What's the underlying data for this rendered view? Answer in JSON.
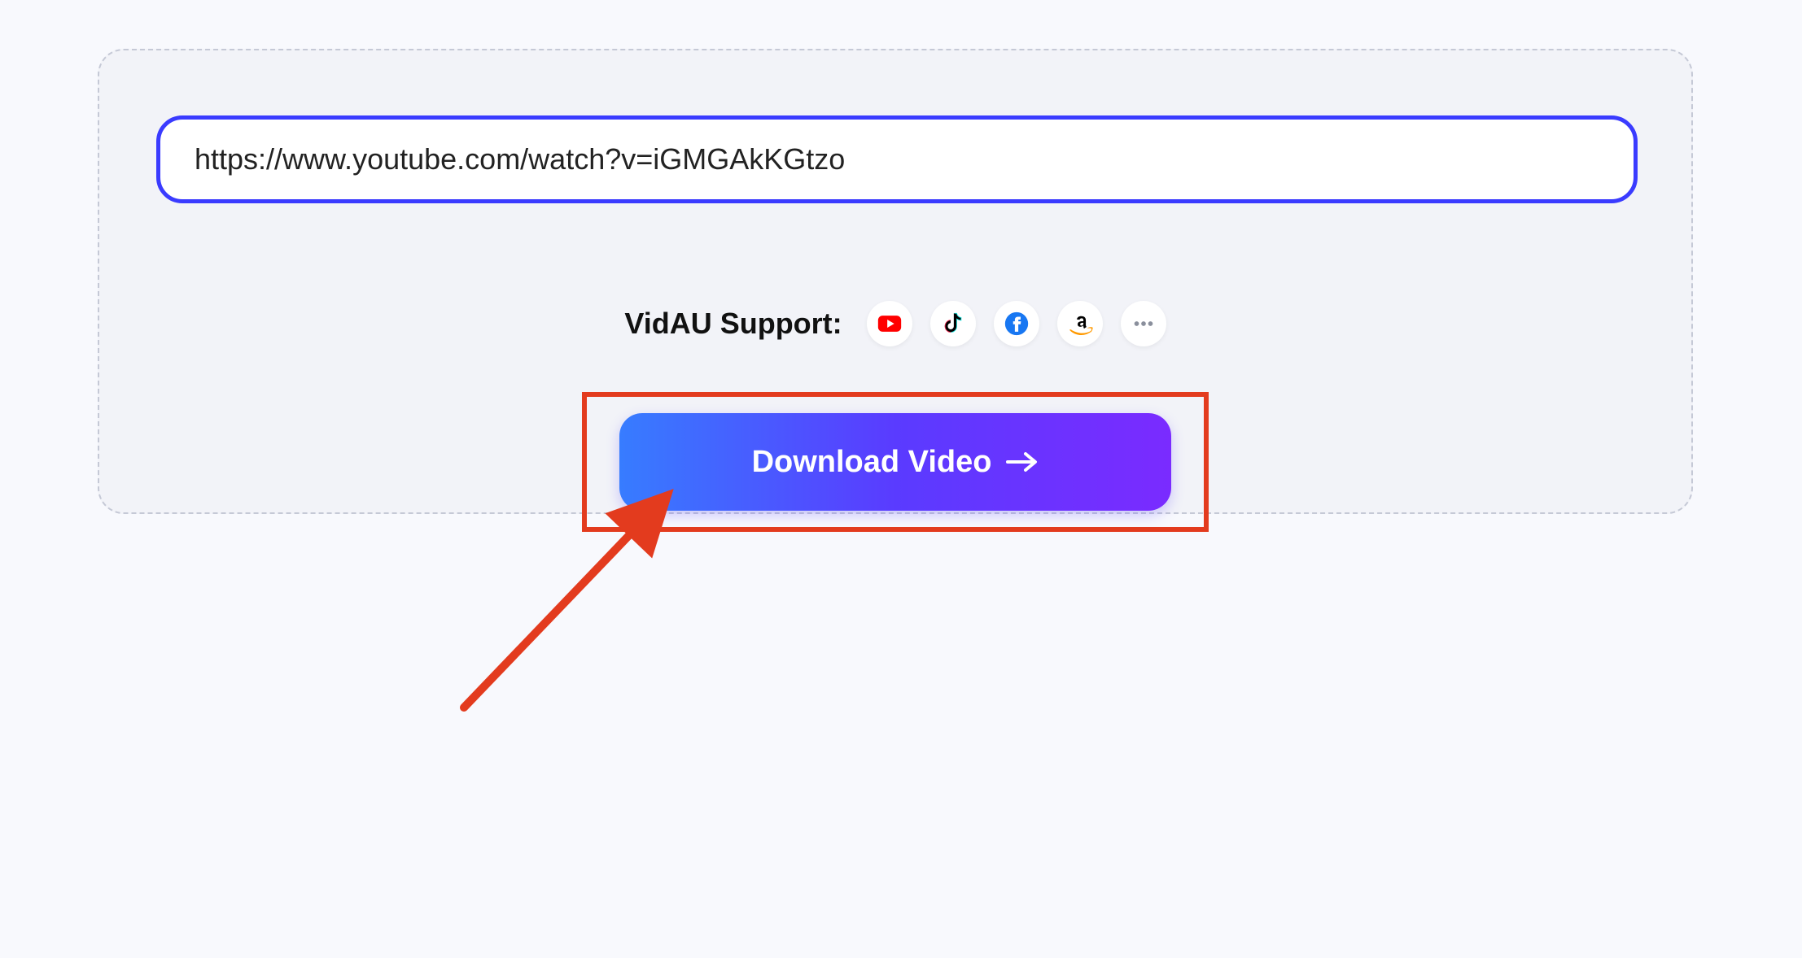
{
  "url_input": {
    "value": "https://www.youtube.com/watch?v=iGMGAkKGtzo"
  },
  "supports": {
    "label": "VidAU Support:",
    "icons": [
      {
        "name": "youtube-icon"
      },
      {
        "name": "tiktok-icon"
      },
      {
        "name": "facebook-icon"
      },
      {
        "name": "amazon-icon"
      },
      {
        "name": "more-icon"
      }
    ]
  },
  "download": {
    "label": "Download Video"
  },
  "annotation": {
    "type": "arrow-highlight",
    "color": "#e33b1e"
  }
}
